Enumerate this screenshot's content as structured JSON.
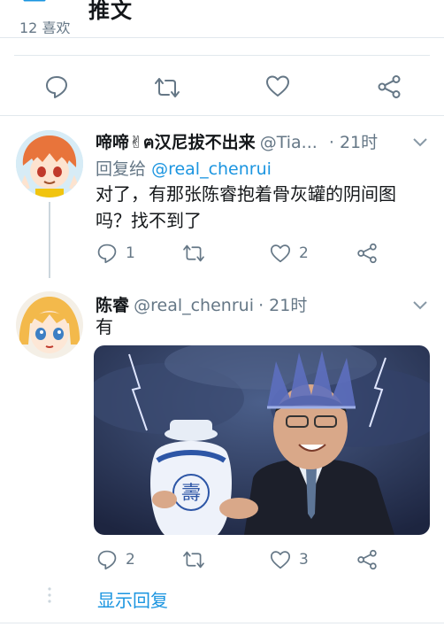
{
  "header": {
    "title": "推文",
    "stat_line": "12 喜欢"
  },
  "main_actions": {
    "reply": "reply",
    "retweet": "retweet",
    "like": "like",
    "share": "share"
  },
  "tweets": [
    {
      "display_name": "啼啼✌ฅ汉尼拔不出来",
      "handle": "@Tia...",
      "time": "· 21时",
      "reply_to_label": "回复给",
      "reply_to_handle": "@real_chenrui",
      "text_line1": "对了，有那张陈睿抱着骨灰罐的阴间图",
      "text_line2": "吗？找不到了",
      "reply_count": "1",
      "retweet_count": "",
      "like_count": "2"
    },
    {
      "display_name": "陈睿",
      "handle": "@real_chenrui",
      "time": "· 21时",
      "text": "有",
      "image_text": "壽",
      "reply_count": "2",
      "retweet_count": "",
      "like_count": "3"
    }
  ],
  "show_replies": "显示回复",
  "colors": {
    "accent": "#1b95e0",
    "icon_gray": "#657786",
    "divider": "#e1e8ed"
  }
}
